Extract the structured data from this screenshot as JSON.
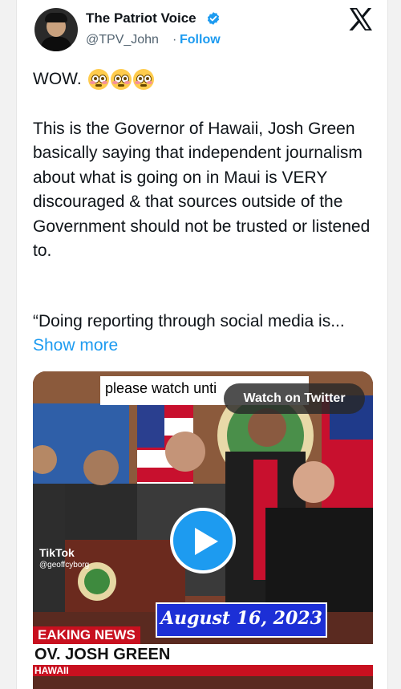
{
  "header": {
    "name": "The Patriot Voice",
    "handle": "@TPV_John",
    "separator": "·",
    "follow_label": "Follow"
  },
  "icons": {
    "verified": "verified-badge-icon",
    "logo": "x-logo-icon",
    "play": "play-icon"
  },
  "colors": {
    "accent": "#1d9bf0",
    "text": "#0f1419",
    "secondary": "#536471"
  },
  "tweet": {
    "wow": "WOW.",
    "emoji_count": 3,
    "body": "This is the Governor of Hawaii, Josh Green basically saying that independent journalism about what is going on in Maui is VERY discouraged & that sources outside of the Government should not be trusted or listened to.",
    "quote": "“Doing reporting through social media is...",
    "show_more": "Show more"
  },
  "media": {
    "banner_text": "please watch unti",
    "watch_label": "Watch on Twitter",
    "tiktok": "TikTok",
    "tiktok_handle": "@geoffcyborg",
    "date": "August 16, 2023",
    "breaking": "EAKING NEWS",
    "lower_third": "OV. JOSH GREEN",
    "location": "HAWAII"
  }
}
